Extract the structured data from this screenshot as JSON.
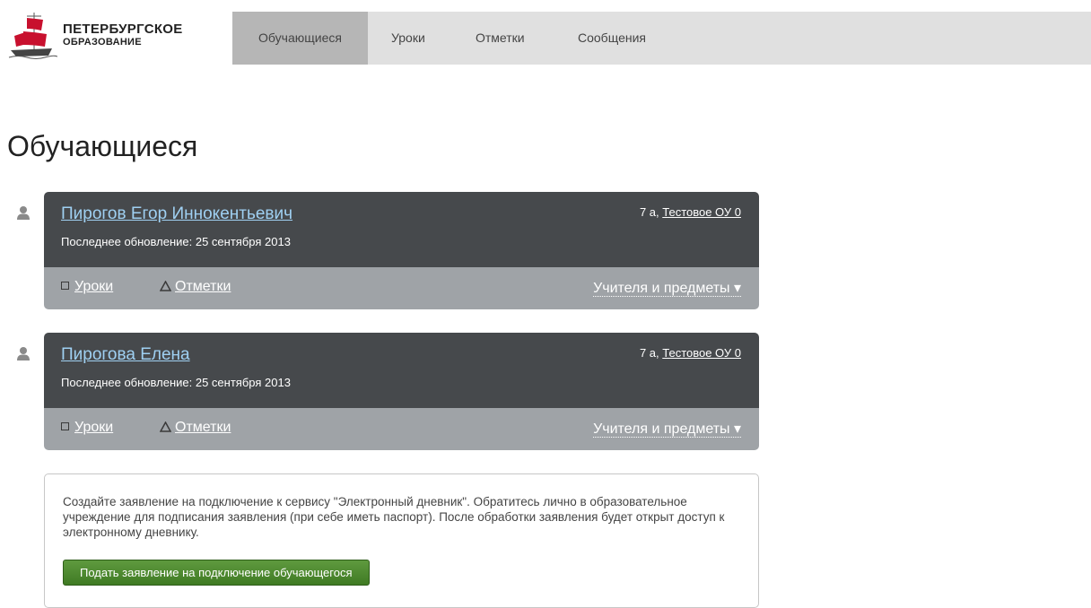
{
  "header": {
    "logo": {
      "line1": "ПЕТЕРБУРГСКОЕ",
      "line2": "ОБРАЗОВАНИЕ"
    },
    "nav": [
      {
        "label": "Обучающиеся",
        "active": true
      },
      {
        "label": "Уроки",
        "active": false
      },
      {
        "label": "Отметки",
        "active": false
      },
      {
        "label": "Сообщения",
        "active": false
      }
    ]
  },
  "page": {
    "title": "Обучающиеся"
  },
  "students": [
    {
      "name": "Пирогов Егор Иннокентьевич",
      "updated": "Последнее обновление: 25 сентября 2013",
      "class": "7 а,",
      "school": "Тестовое ОУ 0",
      "lessons_link": "Уроки",
      "marks_link": "Отметки",
      "teachers_link": "Учителя и предметы ▾"
    },
    {
      "name": "Пирогова Елена",
      "updated": "Последнее обновление: 25 сентября 2013",
      "class": "7 а,",
      "school": "Тестовое ОУ 0",
      "lessons_link": "Уроки",
      "marks_link": "Отметки",
      "teachers_link": "Учителя и предметы ▾"
    }
  ],
  "info": {
    "text": "Создайте заявление на подключение к сервису \"Электронный дневник\". Обратитесь лично в образовательное учреждение для подписания заявления (при себе иметь паспорт). После обработки заявления будет открыт доступ к электронному дневнику.",
    "button_label": "Подать заявление на подключение обучающегося"
  },
  "colors": {
    "card_dark": "#46494c",
    "card_light": "#9fa3a7",
    "link_blue": "#9fd0f2",
    "nav_bg": "#e0e0e0",
    "nav_active": "#b6b6b6",
    "button_green": "#4e8a30",
    "logo_red": "#c8102e"
  }
}
